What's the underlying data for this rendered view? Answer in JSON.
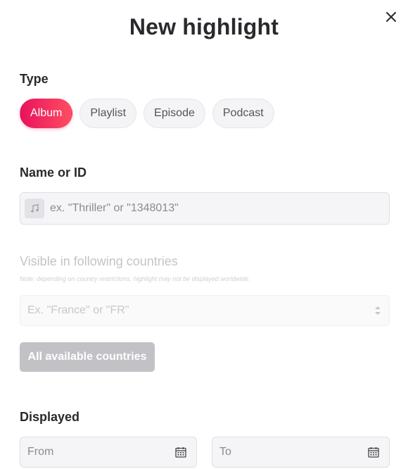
{
  "modal": {
    "title": "New highlight"
  },
  "type_section": {
    "label": "Type",
    "options": [
      "Album",
      "Playlist",
      "Episode",
      "Podcast"
    ],
    "selected": "Album",
    "accent_color": "#e8125c"
  },
  "name_section": {
    "label": "Name or ID",
    "placeholder": "ex. \"Thriller\" or \"1348013\"",
    "value": "",
    "icon": "music-note-icon"
  },
  "countries_section": {
    "label": "Visible in following countries",
    "note": "Note: depending on country restrictions, highlight may not be displayed worldwide.",
    "placeholder": "Ex. \"France\" or \"FR\"",
    "all_button_label": "All available countries",
    "disabled": true
  },
  "displayed_section": {
    "label": "Displayed",
    "from_placeholder": "From",
    "to_placeholder": "To",
    "icon": "calendar-icon"
  }
}
